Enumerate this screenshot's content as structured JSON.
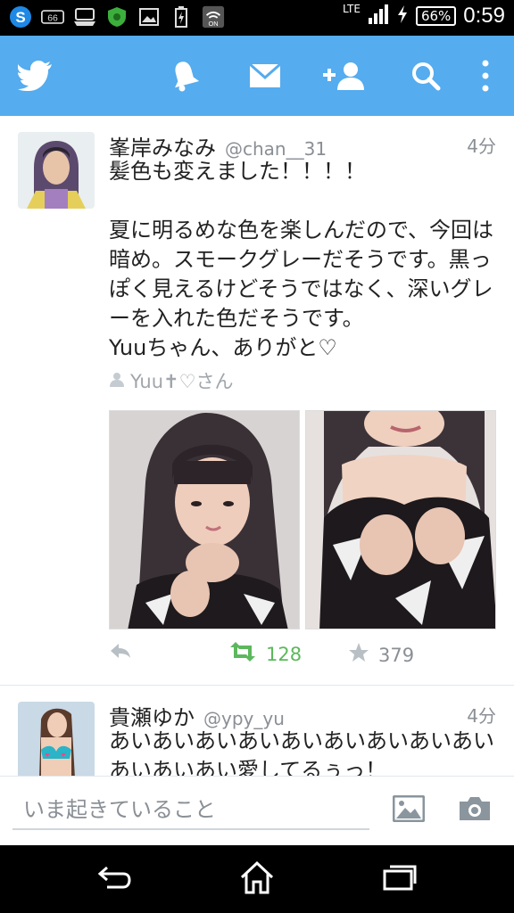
{
  "status_bar": {
    "time": "0:59",
    "battery": "66%",
    "network": "LTE",
    "left_icons": [
      "s-app-icon",
      "voicemail-icon",
      "tray-icon",
      "shield-app-icon",
      "image-icon",
      "battery-charging-icon",
      "wifi-off-icon"
    ],
    "left_badge": "66",
    "on_label": "ON"
  },
  "action_bar": {
    "color": "#55acee",
    "icons": [
      "twitter-bird-icon",
      "notifications-bell-icon",
      "messages-envelope-icon",
      "add-user-icon",
      "search-icon",
      "overflow-menu-icon"
    ]
  },
  "tweets": [
    {
      "name": "峯岸みなみ",
      "handle": "@chan__31",
      "time": "4分",
      "text": "髪色も変えました！！！！\n\n夏に明るめな色を楽しんだので、今回は暗め。スモークグレーだそうです。黒っぽく見えるけどそうではなく、深いグレーを入れた色だそうです。\nYuuちゃん、ありがと♡",
      "retweeted_by": "Yuu✝♡さん",
      "retweets": "128",
      "favorites": "379"
    },
    {
      "name": "貴瀬ゆか",
      "handle": "@ypy_yu",
      "time": "4分",
      "text": "あいあいあいあいあいあいあいあいあいあいあいあい愛してるぅっ！"
    }
  ],
  "compose": {
    "placeholder": "いま起きていること"
  },
  "nav_bar": {
    "icons": [
      "back-icon",
      "home-icon",
      "recent-apps-icon"
    ]
  }
}
